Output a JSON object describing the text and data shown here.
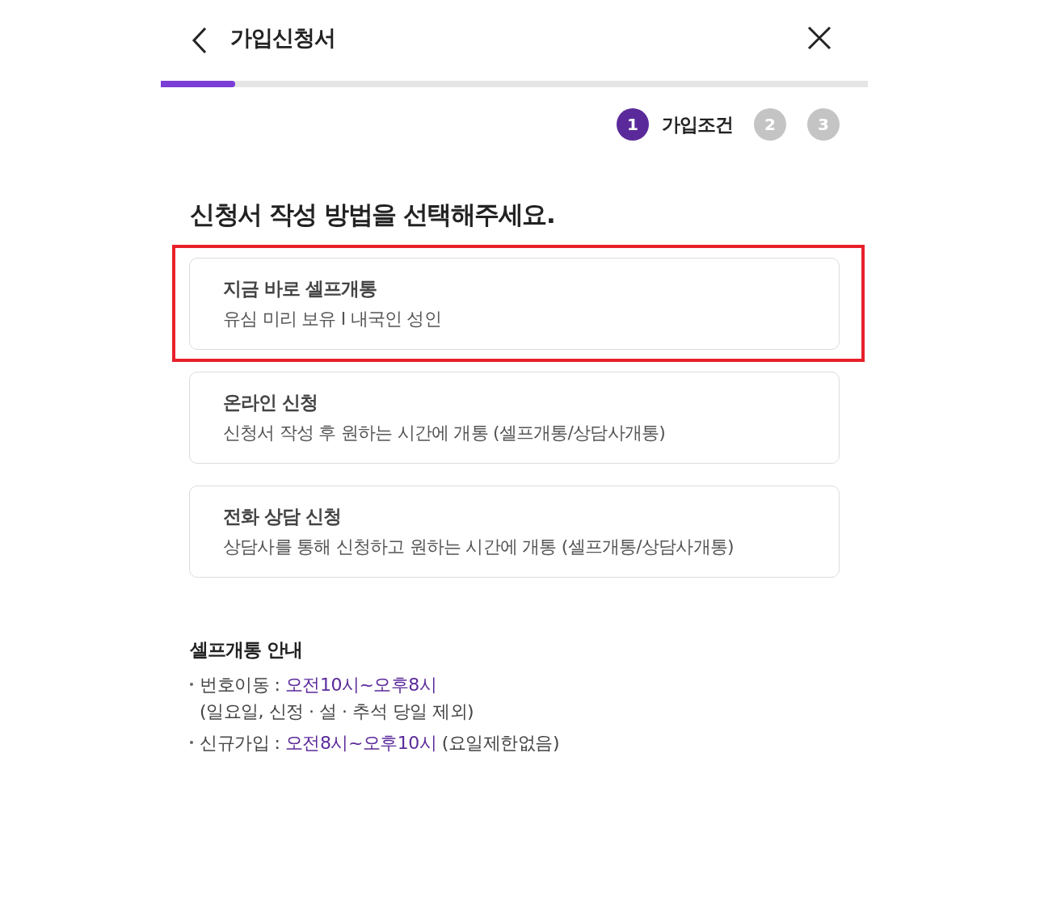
{
  "header": {
    "title": "가입신청서"
  },
  "progress": {
    "level": 0.105
  },
  "steps": [
    {
      "number": "1",
      "label": "가입조건",
      "selected": true
    },
    {
      "number": "2",
      "selected": false
    },
    {
      "number": "3",
      "selected": false
    }
  ],
  "heading": "신청서 작성 방법을 선택해주세요.",
  "options": [
    {
      "title": "지금 바로 셀프개통",
      "subtitle": "유심 미리 보유 I 내국인 성인",
      "highlighted": true
    },
    {
      "title": "온라인 신청",
      "subtitle": "신청서 작성 후 원하는 시간에 개통 (셀프개통/상담사개통)",
      "highlighted": false
    },
    {
      "title": "전화 상담 신청",
      "subtitle": "상담사를 통해 신청하고 원하는 시간에 개통 (셀프개통/상담사개통)",
      "highlighted": false
    }
  ],
  "info": {
    "title": "셀프개통 안내",
    "items": [
      {
        "label": "번호이동 :",
        "time": "오전10시~오후8시",
        "note": "(일요일, 신정 · 설 · 추석 당일 제외)",
        "note_on_new_line": true
      },
      {
        "label": "신규가입 :",
        "time": "오전8시~오후10시",
        "note": "(요일제한없음)",
        "note_on_new_line": false
      }
    ]
  }
}
